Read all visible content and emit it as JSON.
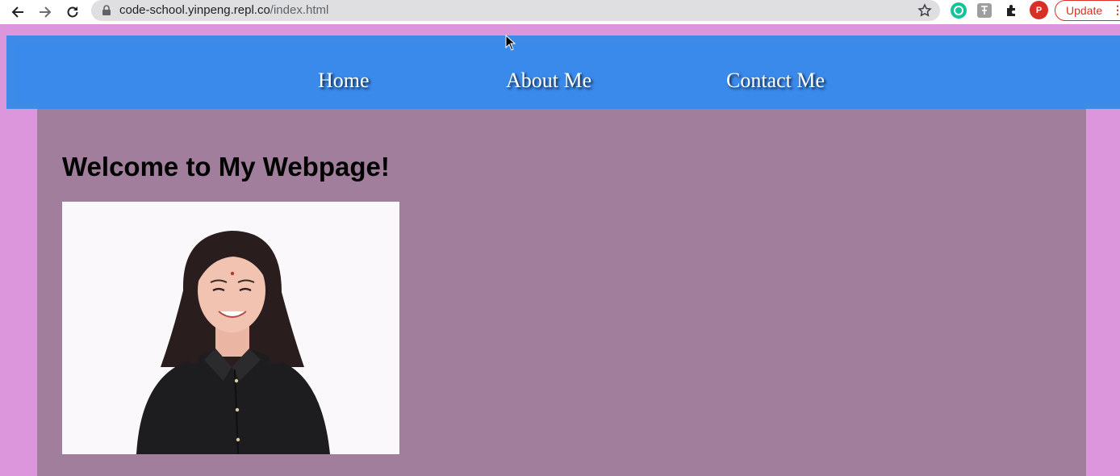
{
  "browser": {
    "url_host": "code-school.yinpeng.repl.co",
    "url_path": "/index.html",
    "profile_initial": "P",
    "update_label": "Update",
    "menu_icon": "⋮",
    "icons": [
      "back-arrow-icon",
      "forward-arrow-icon",
      "reload-icon",
      "lock-icon",
      "bookmark-star-icon",
      "grammarly-icon",
      "translate-extension-icon",
      "extensions-puzzle-icon",
      "profile-avatar-icon",
      "more-menu-icon"
    ],
    "colors": {
      "update": "#d93025",
      "profile": "#d93025",
      "grammarly": "#15c39a"
    }
  },
  "page": {
    "nav": {
      "links": [
        {
          "label": "Home"
        },
        {
          "label": "About Me"
        },
        {
          "label": "Contact Me"
        }
      ]
    },
    "heading": "Welcome to My Webpage!",
    "photo_alt": "portrait photo of a smiling woman in a black shirt",
    "colors": {
      "background": "#dc96dc",
      "navbar": "#3a8aec",
      "content": "#a07e9c"
    }
  }
}
